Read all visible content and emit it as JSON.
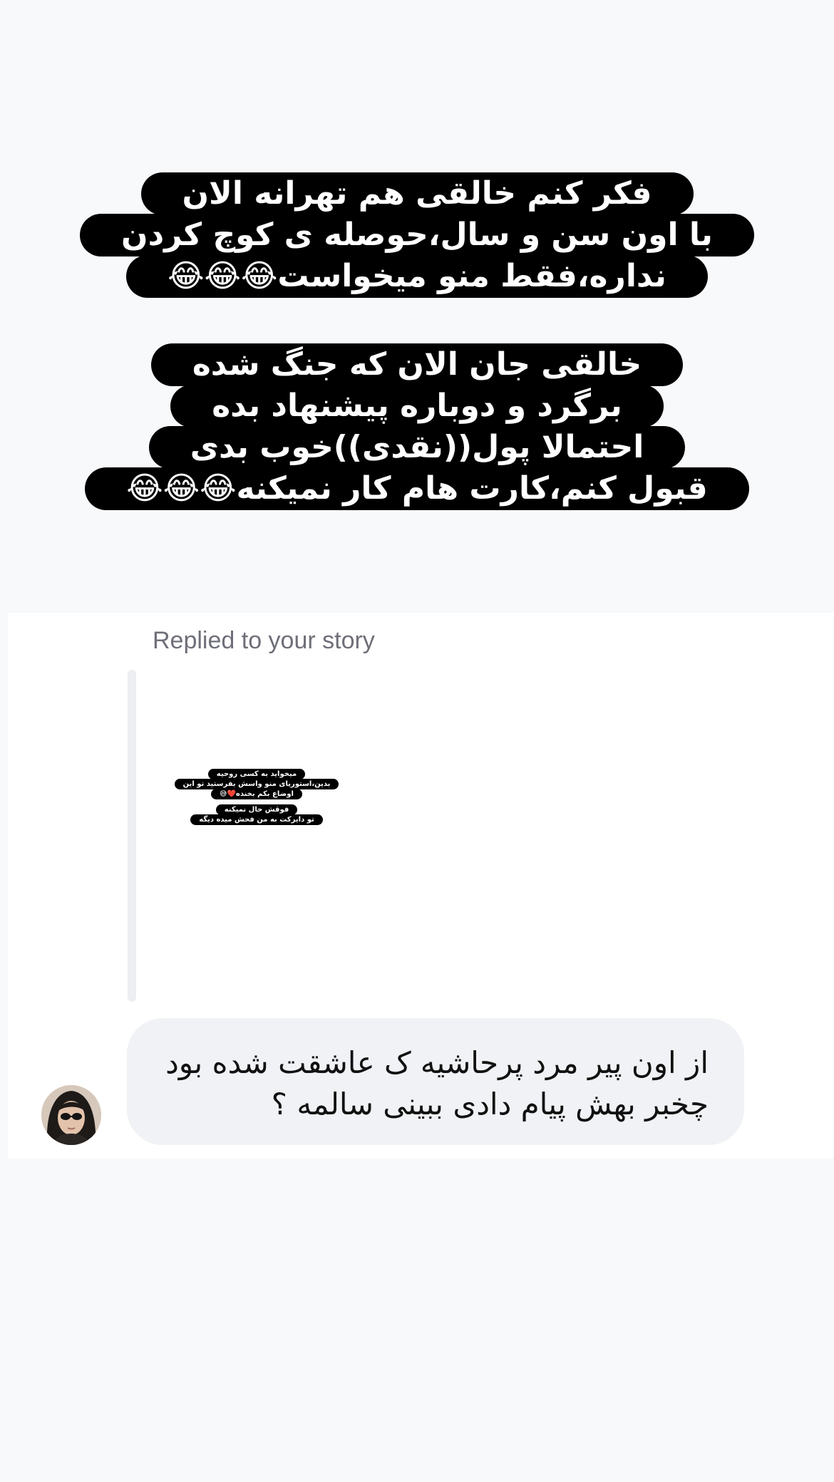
{
  "story_caption": {
    "block1": [
      "فکر کنم خالقی هم تهرانه الان",
      "با اون سن و سال،حوصله ی کوچ کردن",
      "نداره،فقط منو میخواست😂😂😂"
    ],
    "block2": [
      "خالقی جان الان که جنگ شده",
      "برگرد و دوباره پیشنهاد بده",
      "احتمالا پول((نقدی))خوب بدی",
      "قبول کنم،کارت هام کار نمیکنه😂😂😂"
    ]
  },
  "thread": {
    "replied_label": "Replied to your story",
    "story_preview": {
      "group1": [
        "میخواید به کسی روحیه",
        "بدین،استوریای منو واسش بفرستید تو این",
        "اوضاع بکم بخنده❤️😅"
      ],
      "group2": [
        "فوقش حال نمیکنه",
        "تو دایرکت به من فحش میده دیگه"
      ]
    },
    "message": {
      "line1": "از اون پیر مرد پرحاشیه ک عاشقت شده بود",
      "line2": "چخبر بهش پیام دادی ببینی سالمه ؟"
    }
  },
  "colors": {
    "page_background": "#f8f9fb",
    "card_background": "#ffffff",
    "bubble_background": "#f1f2f5",
    "caption_pill": "#000000",
    "caption_text": "#ffffff",
    "muted_text": "#6e6f78"
  }
}
